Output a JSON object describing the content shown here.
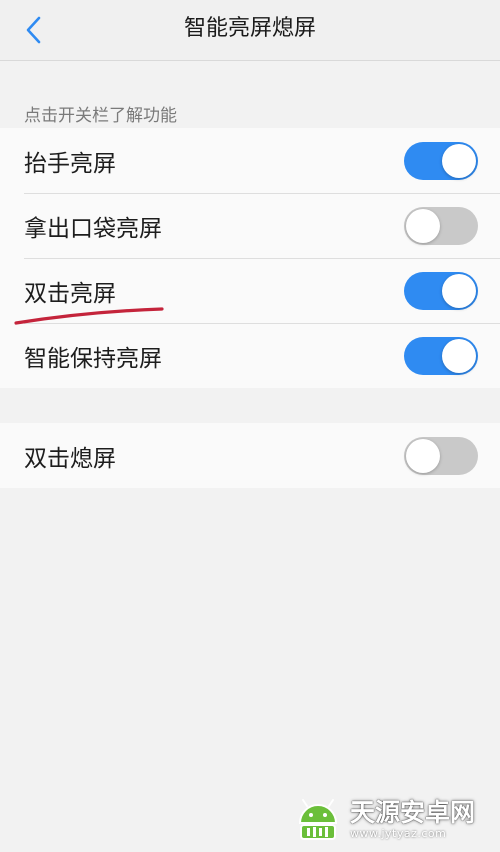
{
  "header": {
    "title": "智能亮屏熄屏",
    "back_icon": "chevron-left-icon"
  },
  "section_hint": "点击开关栏了解功能",
  "group1": {
    "items": [
      {
        "label": "抬手亮屏",
        "on": true
      },
      {
        "label": "拿出口袋亮屏",
        "on": false
      },
      {
        "label": "双击亮屏",
        "on": true
      },
      {
        "label": "智能保持亮屏",
        "on": true
      }
    ]
  },
  "group2": {
    "items": [
      {
        "label": "双击熄屏",
        "on": false
      }
    ]
  },
  "annotation": {
    "color": "#c4243b"
  },
  "watermark": {
    "name": "天源安卓网",
    "url": "www.jytyaz.com"
  },
  "colors": {
    "accent": "#2f8bf2",
    "toggle_off": "#c9c9c9",
    "background": "#f2f2f2"
  }
}
